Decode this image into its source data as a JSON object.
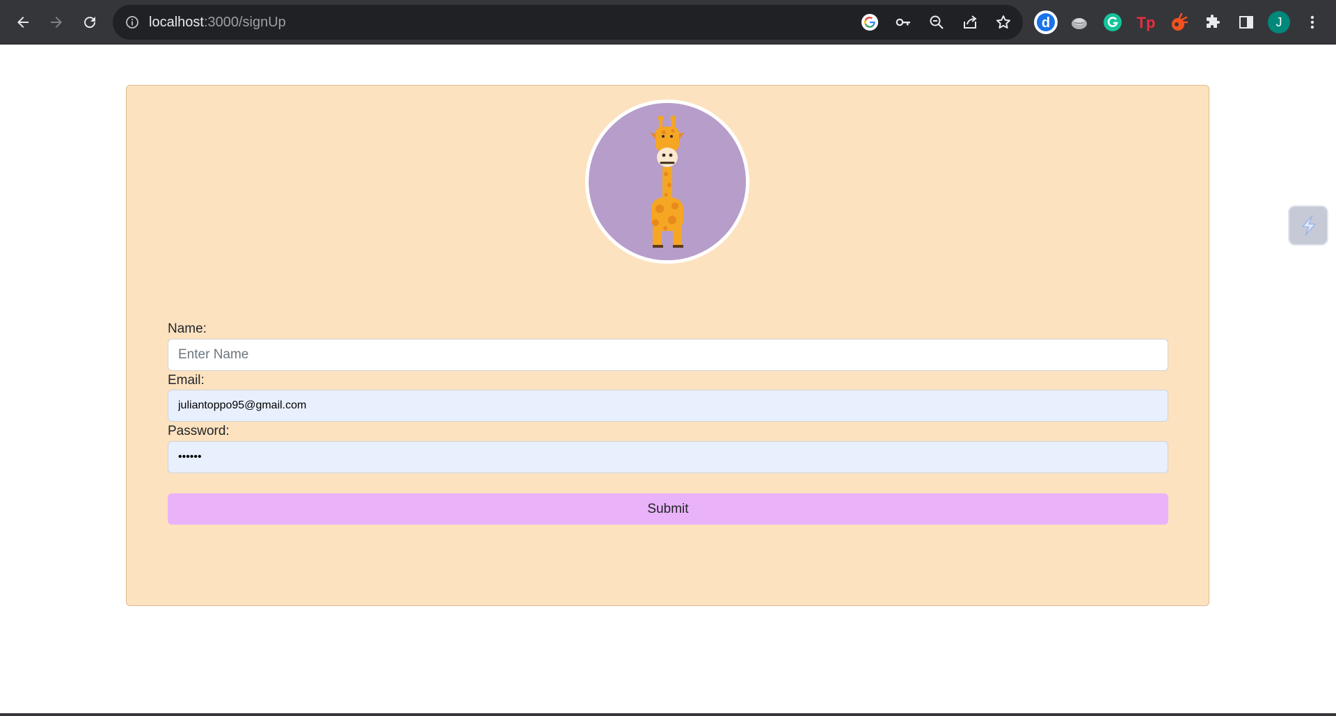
{
  "browser": {
    "url_host": "localhost",
    "url_path": ":3000/signUp",
    "profile_initial": "J",
    "icons": {
      "back": "back-arrow-icon",
      "forward": "forward-arrow-icon",
      "reload": "reload-icon",
      "site_info": "info-icon",
      "google": "google-lens-icon",
      "password": "key-icon",
      "zoom": "zoom-out-icon",
      "share": "share-icon",
      "bookmark": "star-icon",
      "extensions": [
        "dictionary-extension-icon",
        "cloud-extension-icon",
        "grammarly-extension-icon",
        "tp-extension-icon",
        "rocket-extension-icon",
        "puzzle-extensions-icon",
        "side-panel-icon"
      ],
      "menu": "kebab-menu-icon"
    },
    "colors": {
      "toolbar": "#35363a",
      "omnibox": "#202124"
    }
  },
  "form": {
    "avatar": "giraffe-avatar",
    "name": {
      "label": "Name:",
      "placeholder": "Enter Name",
      "value": ""
    },
    "email": {
      "label": "Email:",
      "value": "juliantoppo95@gmail.com"
    },
    "password": {
      "label": "Password:",
      "value": "••••••"
    },
    "submit_label": "Submit"
  },
  "colors": {
    "card_background": "#fde2c0",
    "avatar_background": "#b79dca",
    "submit_background": "#eab3f9",
    "autofill_background": "#e8f0fe"
  }
}
